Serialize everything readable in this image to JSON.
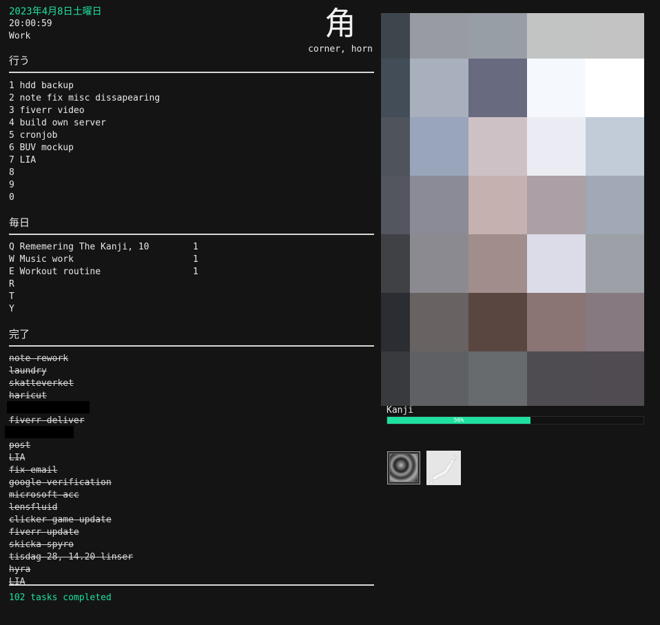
{
  "header": {
    "date": "2023年4月8日土曜日",
    "time": "20:00:59",
    "context": "Work",
    "kanji": "角",
    "kanji_meaning": "corner, horn"
  },
  "todo": {
    "title": "行う",
    "items": [
      "1 hdd backup",
      "2 note fix misc dissapearing",
      "3 fiverr video",
      "4 build own server",
      "5 cronjob",
      "6 BUV mockup",
      "7 LIA",
      "8",
      "9",
      "0"
    ]
  },
  "daily": {
    "title": "毎日",
    "items": [
      {
        "label": "Q Rememering The Kanji, 10",
        "count": "1"
      },
      {
        "label": "W Music work",
        "count": "1"
      },
      {
        "label": "E Workout routine",
        "count": "1"
      },
      {
        "label": "R",
        "count": ""
      },
      {
        "label": "T",
        "count": ""
      },
      {
        "label": "Y",
        "count": ""
      }
    ]
  },
  "done": {
    "title": "完了",
    "items": [
      "note rework",
      "laundry",
      "skatteverket",
      "haricut",
      "",
      "fiverr deliver",
      "",
      "post",
      "LIA",
      "fix email",
      "google verification",
      "microsoft acc",
      "lensfluid",
      "clicker game update",
      "fiverr update",
      "skicka spyro",
      "tisdag 28, 14.20 linser",
      "hyra",
      "LIA"
    ],
    "total": "102 tasks completed"
  },
  "mosaic": {
    "colors": [
      [
        "#3e464d",
        "#989ca2",
        "#989ea6",
        "#c2c4c4",
        "#c3c3c3"
      ],
      [
        "#434d57",
        "#a7b0bc",
        "#686a80",
        "#f5f9fd",
        "#ffffff"
      ],
      [
        "#4f545c",
        "#98a5ba",
        "#cdc1c6",
        "#ebecf3",
        "#c2ccd8"
      ],
      [
        "#53565f",
        "#8a8b97",
        "#c5b1b0",
        "#ac9fa6",
        "#a0a9b5"
      ],
      [
        "#404145",
        "#8b8a90",
        "#a18d8c",
        "#dbdce8",
        "#9da1a7"
      ],
      [
        "#2c2d32",
        "#686262",
        "#5a4641",
        "#8b7474",
        "#86797f"
      ],
      [
        "#383a3e",
        "#5e6063",
        "#676b6e",
        "#4e4c50",
        "#504a51"
      ]
    ]
  },
  "kanji_progress": {
    "label": "Kanji",
    "percent": 56,
    "percent_label": "56%",
    "color": "#1fe0a0"
  },
  "thumbnails": [
    {
      "name": "tile-thumbnail"
    },
    {
      "name": "japan-map-thumbnail"
    }
  ]
}
